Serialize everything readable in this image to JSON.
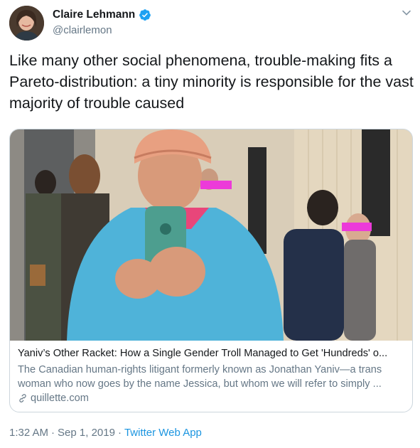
{
  "author": {
    "name": "Claire Lehmann",
    "handle": "@clairlemon",
    "verified": true,
    "avatar_icon": "profile-photo"
  },
  "tweet": {
    "text": "Like many other social phenomena, trouble-making fits a Pareto-distribution: a tiny minority is responsible for the vast majority of trouble caused"
  },
  "card": {
    "image_description_icon": "link-preview-photo",
    "title": "Yaniv’s Other Racket: How a Single Gender Troll Managed to Get 'Hundreds' o...",
    "description_line1": "The Canadian human-rights litigant formerly known as Jonathan Yaniv—a trans",
    "description_line2": "woman who now goes by the name Jessica, but whom we will refer to simply ...",
    "domain": "quillette.com"
  },
  "meta": {
    "time": "1:32 AM",
    "separator1": "·",
    "date": "Sep 1, 2019",
    "separator2": "·",
    "source": "Twitter Web App"
  },
  "colors": {
    "accent": "#1da1f2",
    "link": "#1b95e0",
    "secondary_text": "#657786",
    "border": "#ccd6dd"
  }
}
